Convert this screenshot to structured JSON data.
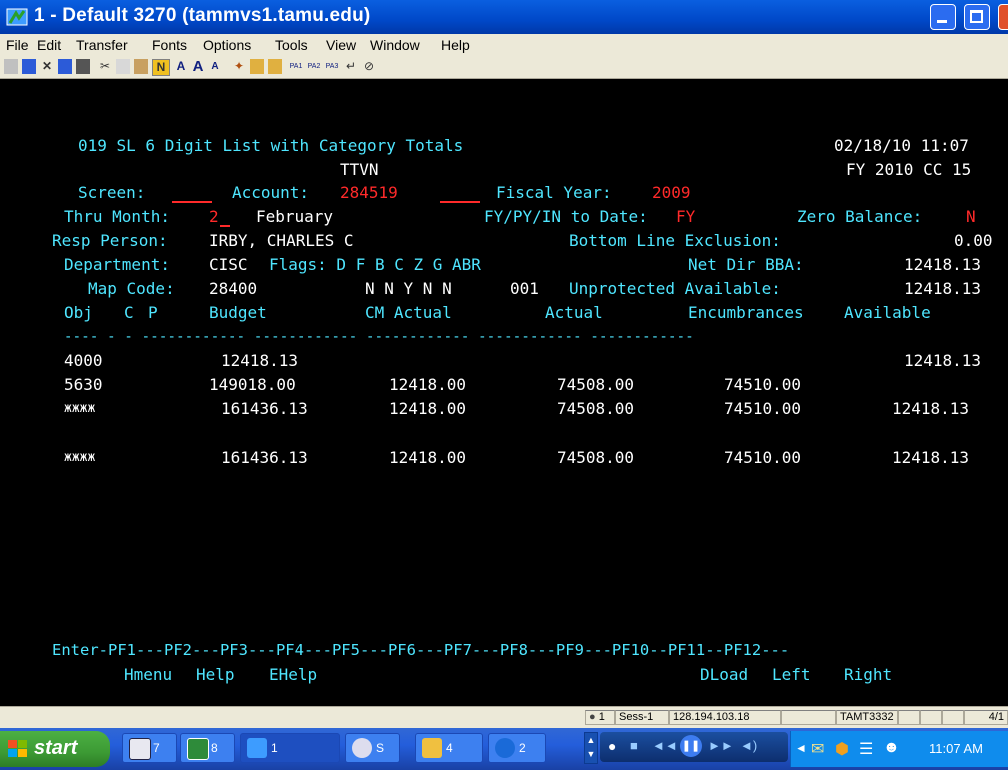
{
  "window": {
    "title": "1 - Default 3270 (tammvs1.tamu.edu)"
  },
  "menu": [
    "File",
    "Edit",
    "Transfer",
    "Fonts",
    "Options",
    "Tools",
    "View",
    "Window",
    "Help"
  ],
  "toolbar": {
    "pf_keys": [
      "PA1",
      "PA2",
      "PA3"
    ]
  },
  "screen": {
    "title": "019 SL 6 Digit List with Category Totals",
    "datetime": "02/18/10 11:07",
    "subtitle": "TTVN",
    "fy_line": "FY 2010 CC 15",
    "screen_label": "Screen:",
    "account_label": "Account:",
    "account_value": "284519",
    "fiscal_year_label": "Fiscal Year:",
    "fiscal_year_value": "2009",
    "thru_month_label": "Thru Month:",
    "thru_month_value": "2",
    "thru_month_name": "February",
    "to_date_label": "FY/PY/IN to Date:",
    "to_date_value": "FY",
    "zero_balance_label": "Zero Balance:",
    "zero_balance_value": "N",
    "resp_person_label": "Resp Person:",
    "resp_person_value": "IRBY, CHARLES C",
    "bottom_line_label": "Bottom Line Exclusion:",
    "bottom_line_value": "0.00",
    "department_label": "Department:",
    "department_value": "CISC",
    "flags_label": "Flags: D F B C Z G ABR",
    "net_dir_bba_label": "Net Dir BBA:",
    "net_dir_bba_value": "12418.13",
    "map_code_label": "Map Code:",
    "map_code_value": "28400",
    "flags_values": "N N Y N N",
    "abr_value": "001",
    "unprotected_label": "Unprotected Available:",
    "unprotected_value": "12418.13",
    "columns": {
      "obj": "Obj",
      "c": "C",
      "p": "P",
      "budget": "Budget",
      "cm_actual": "CM Actual",
      "actual": "Actual",
      "encumbrances": "Encumbrances",
      "available": "Available"
    },
    "separator": "---- - - ------------ ------------ ------------ ------------ ------------",
    "rows": [
      {
        "obj": "4000",
        "budget": "12418.13",
        "cm_actual": "",
        "actual": "",
        "encumbrances": "",
        "available": "12418.13"
      },
      {
        "obj": "5630",
        "budget": "149018.00",
        "cm_actual": "12418.00",
        "actual": "74508.00",
        "encumbrances": "74510.00",
        "available": ""
      },
      {
        "obj": "жжжж",
        "budget": "161436.13",
        "cm_actual": "12418.00",
        "actual": "74508.00",
        "encumbrances": "74510.00",
        "available": "12418.13"
      },
      {
        "obj": "жжжж",
        "budget": "161436.13",
        "cm_actual": "12418.00",
        "actual": "74508.00",
        "encumbrances": "74510.00",
        "available": "12418.13"
      }
    ],
    "pf_line": "Enter-PF1---PF2---PF3---PF4---PF5---PF6---PF7---PF8---PF9---PF10--PF11--PF12---",
    "pf_labels": {
      "pf1": "Hmenu",
      "pf2": "Help",
      "pf3": "EHelp",
      "pf9": "DLoad",
      "pf10": "Left",
      "pf11": "Right"
    }
  },
  "statusbar": {
    "indicator": "1",
    "session": "Sess-1",
    "ip": "128.194.103.18",
    "lu": "TAMT3332",
    "pos": "4/1"
  },
  "taskbar": {
    "start": "start",
    "tasks": [
      {
        "count": "7"
      },
      {
        "count": "8"
      },
      {
        "label": "1"
      },
      {
        "label": "S"
      },
      {
        "count": "4"
      },
      {
        "count": "2"
      }
    ],
    "clock": "11:07 AM"
  },
  "colors": {
    "terminal_bg": "#000000",
    "terminal_cyan": "#4fe6ff",
    "terminal_red": "#ff2a2a",
    "terminal_white": "#ffffff",
    "title_blue": "#0048c8"
  }
}
